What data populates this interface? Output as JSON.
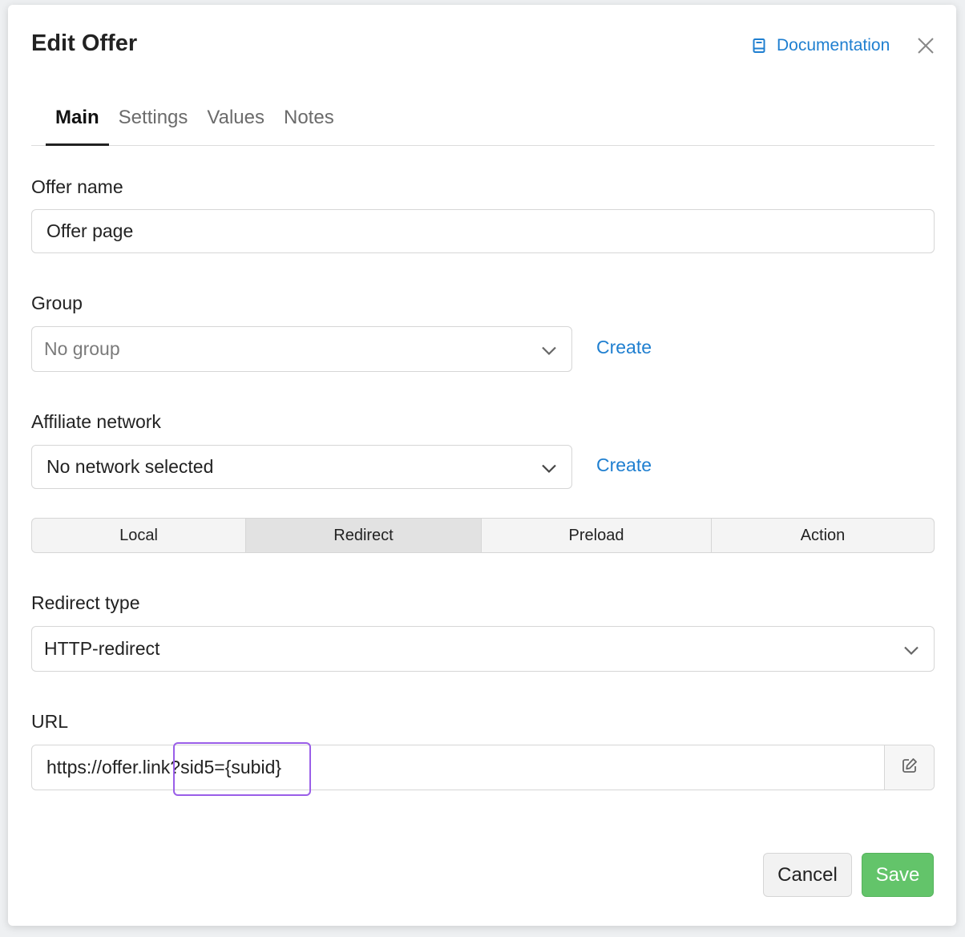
{
  "dialog": {
    "title": "Edit Offer",
    "documentation_label": "Documentation"
  },
  "tabs": [
    {
      "label": "Main",
      "active": true
    },
    {
      "label": "Settings",
      "active": false
    },
    {
      "label": "Values",
      "active": false
    },
    {
      "label": "Notes",
      "active": false
    }
  ],
  "fields": {
    "offer_name": {
      "label": "Offer name",
      "value": "Offer page"
    },
    "group": {
      "label": "Group",
      "value": "No group",
      "create_label": "Create"
    },
    "affiliate_network": {
      "label": "Affiliate network",
      "value": "No network selected",
      "create_label": "Create"
    },
    "redirect_type": {
      "label": "Redirect type",
      "value": "HTTP-redirect"
    },
    "url": {
      "label": "URL",
      "value": "https://offer.link?sid5={subid}"
    }
  },
  "mode_segments": [
    {
      "label": "Local",
      "active": false
    },
    {
      "label": "Redirect",
      "active": true
    },
    {
      "label": "Preload",
      "active": false
    },
    {
      "label": "Action",
      "active": false
    }
  ],
  "footer": {
    "cancel_label": "Cancel",
    "save_label": "Save"
  },
  "colors": {
    "link": "#1f7fd0",
    "save": "#63c46a",
    "highlight": "#9a5ee8"
  }
}
